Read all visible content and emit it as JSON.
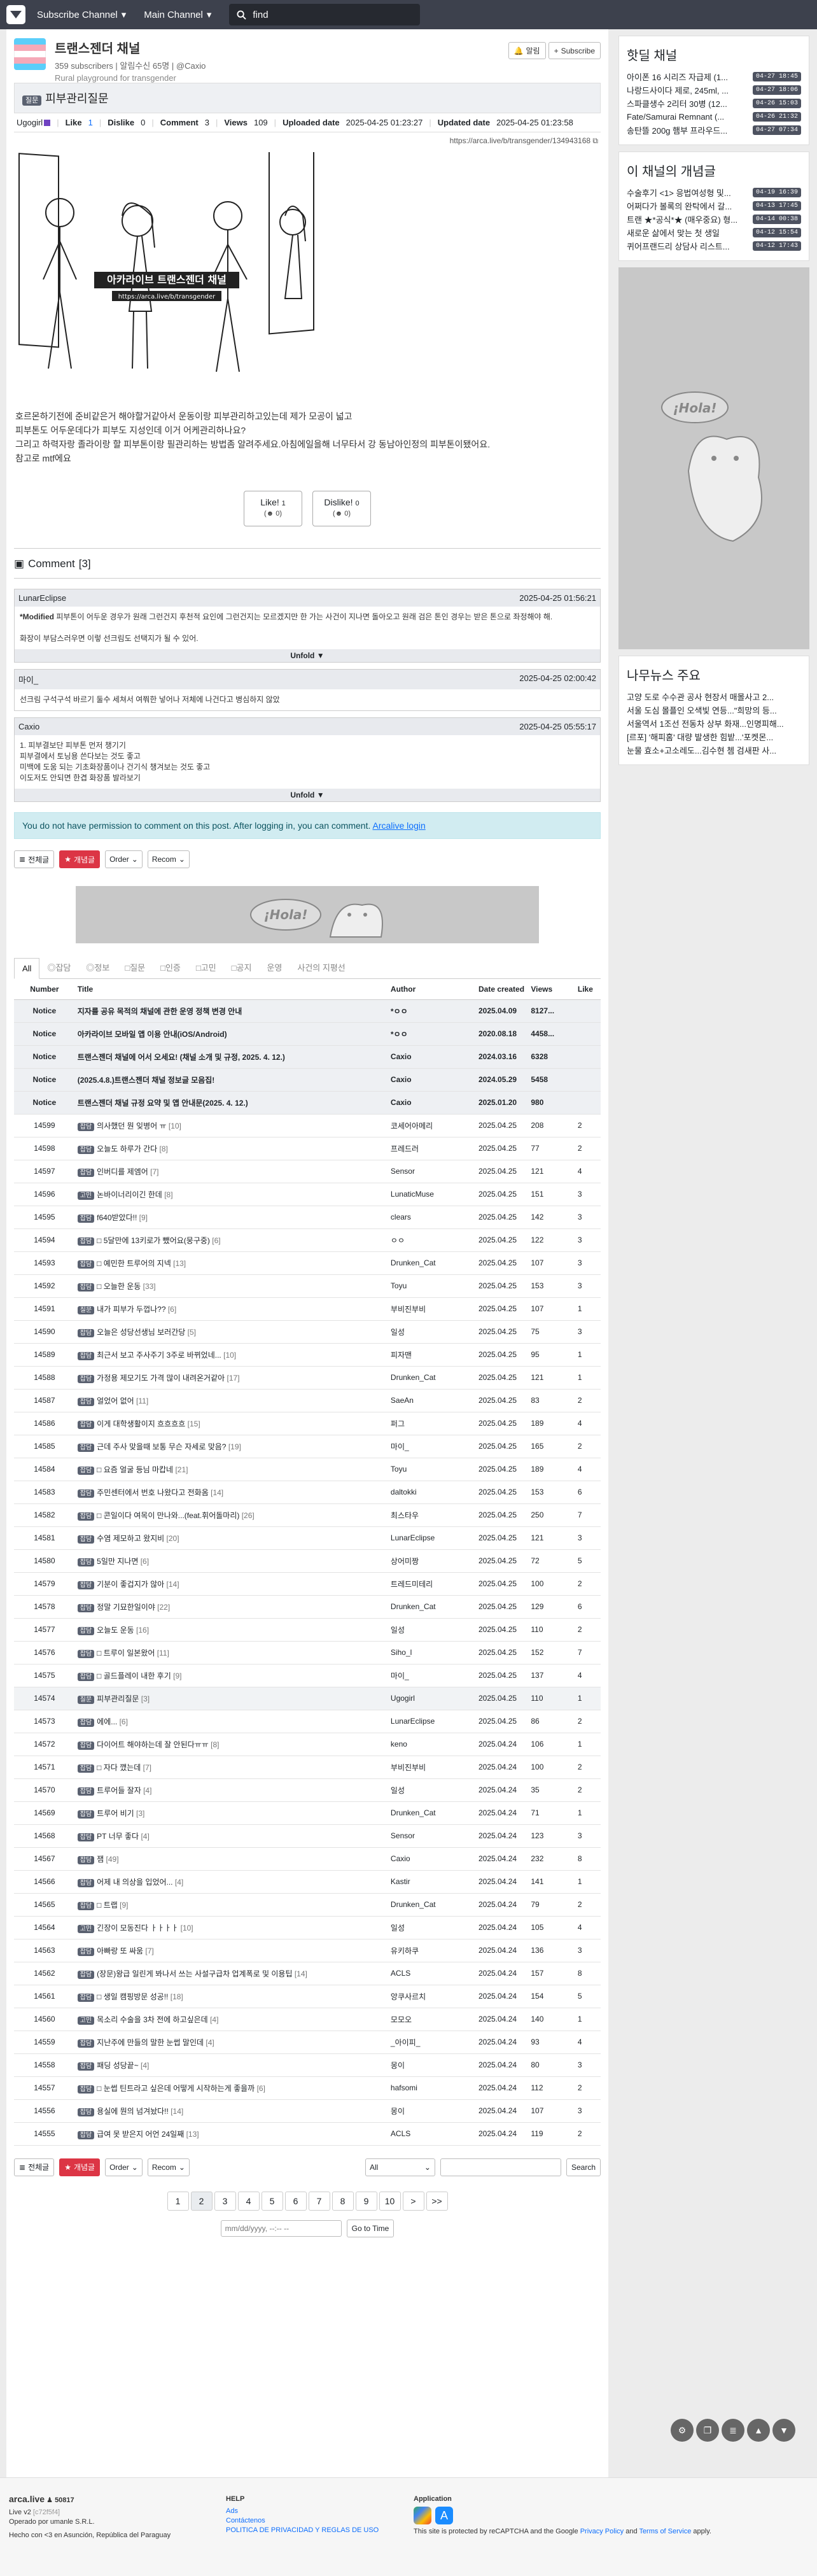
{
  "nav": {
    "menu1": "Subscribe Channel",
    "menu2": "Main Channel",
    "search_placeholder": "find"
  },
  "channel": {
    "name": "트랜스젠더 채널",
    "subscribers": "359 subscribers",
    "notify": "알림수신 65명",
    "owner": "@Caxio",
    "desc": "Rural playground for transgender",
    "notify_btn": "알림",
    "subscribe_btn": "Subscribe"
  },
  "post": {
    "category": "질문",
    "title": "피부관리질문",
    "author": "Ugogirl",
    "like_label": "Like",
    "like": "1",
    "dislike_label": "Dislike",
    "dislike": "0",
    "comment_label": "Comment",
    "comment": "3",
    "views_label": "Views",
    "views": "109",
    "uploaded_label": "Uploaded date",
    "uploaded": "2025-04-25 01:23:27",
    "updated_label": "Updated date",
    "updated": "2025-04-25 01:23:58",
    "url": "https://arca.live/b/transgender/134943168",
    "image_text1": "아카라이브 트랜스젠더 채널",
    "image_text2": "https://arca.live/b/transgender",
    "body": [
      "호르몬하기전에 준비같은거 해야할거같아서 운동이랑 피부관리하고있는데 제가 모공이 넓고",
      "피부톤도 어두운데다가 피부도 지성인데 이거 어케관리하나요?",
      "그리고 하력자랑 졸라이랑 할 피부톤이랑 필관리하는 방법좀 알려주세요.아침에일을해 너무타서 강 동남아인정의 피부톤이됐어요.",
      "참고로 mtf에요"
    ],
    "like_btn": "Like!",
    "like_count": "1",
    "like_sub": "0",
    "dislike_btn": "Dislike!",
    "dislike_count": "0",
    "dislike_sub": "0"
  },
  "comments": {
    "title": "Comment",
    "count": "[3]",
    "items": [
      {
        "author": "LunarEclipse",
        "date": "2025-04-25 01:56:21",
        "modified": "*Modified",
        "text": "피부톤이 어두운 경우가 원래 그런건지 후천적 요인에 그런건지는 모르겠지만 한 가는 사건이 지나면 돌아오고 원래 검은 톤인 경우는 받은 톤으로 좌정해야 해.",
        "text2": "화장이 부담스러우면 이렇 선크림도 선택지가 될 수 있어.",
        "unfold": "Unfold"
      },
      {
        "author": "마이_",
        "date": "2025-04-25 02:00:42",
        "text": "선크림 구석구석 바르기 둘수 세쳐서 여쭤한 넣어나 저체에 나건다고 병심하지 않았",
        "unfold": ""
      },
      {
        "author": "Caxio",
        "date": "2025-04-25 05:55:17",
        "lines": [
          "1. 피부결보단 피부톤 먼저 챙기기",
          "피부결에서 토닝용 쓴다보는 것도 좋고",
          "미백에 도움 되는 기초화장품이나 건기식 챙겨보는 것도 좋고",
          "이도저도 안되면 한겹 화장품 발라보기"
        ],
        "unfold": "Unfold"
      }
    ]
  },
  "alert": {
    "text": "You do not have permission to comment on this post. After logging in, you can comment.",
    "link": "Arcalive login"
  },
  "filters": {
    "all": "전체글",
    "best": "개념글",
    "order": "Order",
    "recom": "Recom"
  },
  "ad": {
    "text": "¡Hola!"
  },
  "tabs": [
    "All",
    "잡담",
    "정보",
    "질문",
    "인증",
    "고민",
    "공지",
    "운영",
    "사건의 지평선"
  ],
  "table": {
    "headers": [
      "Number",
      "Title",
      "Author",
      "Date created",
      "Views",
      "Like"
    ],
    "notices": [
      {
        "num": "Notice",
        "title": "지자를 공유 목적의 채널에 관한 운영 정책 변경 안내",
        "author": "*ㅇㅇ",
        "date": "2025.04.09",
        "views": "8127...",
        "like": ""
      },
      {
        "num": "Notice",
        "title": "아카라이브 모바일 앱 이용 안내(iOS/Android)",
        "author": "*ㅇㅇ",
        "date": "2020.08.18",
        "views": "4458...",
        "like": ""
      },
      {
        "num": "Notice",
        "title": "트랜스젠더 채널에 어서 오세요! (채널 소개 및 규정, 2025. 4. 12.)",
        "author": "Caxio",
        "date": "2024.03.16",
        "views": "6328",
        "like": ""
      },
      {
        "num": "Notice",
        "title": "(2025.4.8.)트랜스젠더 채널 정보글 모음집!",
        "author": "Caxio",
        "date": "2024.05.29",
        "views": "5458",
        "like": ""
      },
      {
        "num": "Notice",
        "title": "트랜스젠더 채널 규정 요약 및 앱 안내문(2025. 4. 12.)",
        "author": "Caxio",
        "date": "2025.01.20",
        "views": "980",
        "like": ""
      }
    ],
    "rows": [
      {
        "num": "14599",
        "cat": "잡담",
        "title": "의사했던 뭔 잊병어 ㅠ",
        "cm": "[10]",
        "author": "코세어아메리",
        "date": "2025.04.25",
        "views": "208",
        "like": "2"
      },
      {
        "num": "14598",
        "cat": "잡담",
        "title": "오늘도 하루가 간다",
        "cm": "[8]",
        "author": "프레드러",
        "date": "2025.04.25",
        "views": "77",
        "like": "2"
      },
      {
        "num": "14597",
        "cat": "잡담",
        "title": "인버디를 제엠어",
        "cm": "[7]",
        "author": "Sensor",
        "date": "2025.04.25",
        "views": "121",
        "like": "4"
      },
      {
        "num": "14596",
        "cat": "고민",
        "title": "논바이너리이긴 한데",
        "cm": "[8]",
        "author": "LunaticMuse",
        "date": "2025.04.25",
        "views": "151",
        "like": "3"
      },
      {
        "num": "14595",
        "cat": "잡담",
        "title": "f640받았다!!",
        "cm": "[9]",
        "author": "clears",
        "date": "2025.04.25",
        "views": "142",
        "like": "3"
      },
      {
        "num": "14594",
        "cat": "잡담",
        "title": "□ 5달만에 13키로가 뺐어요(뭉구중)",
        "cm": "[6]",
        "author": "ㅇㅇ",
        "date": "2025.04.25",
        "views": "122",
        "like": "3"
      },
      {
        "num": "14593",
        "cat": "잡담",
        "title": "□ 예민한 트루어의 지넥",
        "cm": "[13]",
        "author": "Drunken_Cat",
        "date": "2025.04.25",
        "views": "107",
        "like": "3"
      },
      {
        "num": "14592",
        "cat": "잡담",
        "title": "□ 오늘한 운동",
        "cm": "[33]",
        "author": "Toyu",
        "date": "2025.04.25",
        "views": "153",
        "like": "3"
      },
      {
        "num": "14591",
        "cat": "질문",
        "title": "내가 피부가 두껍나??",
        "cm": "[6]",
        "author": "부비진부비",
        "date": "2025.04.25",
        "views": "107",
        "like": "1"
      },
      {
        "num": "14590",
        "cat": "잡담",
        "title": "오늘은 성당선생님 보러간당",
        "cm": "[5]",
        "author": "일성",
        "date": "2025.04.25",
        "views": "75",
        "like": "3"
      },
      {
        "num": "14589",
        "cat": "잡담",
        "title": "최근서 보고 주사주기 3주로 바뀌었네...",
        "cm": "[10]",
        "author": "피자맨",
        "date": "2025.04.25",
        "views": "95",
        "like": "1"
      },
      {
        "num": "14588",
        "cat": "잡담",
        "title": "가정용 제모기도 가격 많이 내려온거같아",
        "cm": "[17]",
        "author": "Drunken_Cat",
        "date": "2025.04.25",
        "views": "121",
        "like": "1"
      },
      {
        "num": "14587",
        "cat": "잡담",
        "title": "얼었어 없어",
        "cm": "[11]",
        "author": "SaeAn",
        "date": "2025.04.25",
        "views": "83",
        "like": "2"
      },
      {
        "num": "14586",
        "cat": "잡담",
        "title": "이게 대학생활이지 흐흐흐흐",
        "cm": "[15]",
        "author": "퍼그",
        "date": "2025.04.25",
        "views": "189",
        "like": "4"
      },
      {
        "num": "14585",
        "cat": "잡담",
        "title": "근데 주사 맞을때 보통 무슨 자세로 맞음?",
        "cm": "[19]",
        "author": "마이_",
        "date": "2025.04.25",
        "views": "165",
        "like": "2"
      },
      {
        "num": "14584",
        "cat": "잡담",
        "title": "□ 요즘 얼굴 등님 마캅네",
        "cm": "[21]",
        "author": "Toyu",
        "date": "2025.04.25",
        "views": "189",
        "like": "4"
      },
      {
        "num": "14583",
        "cat": "잡담",
        "title": "주민센터에서 번호 나왔다고 전화옴",
        "cm": "[14]",
        "author": "daltokki",
        "date": "2025.04.25",
        "views": "153",
        "like": "6"
      },
      {
        "num": "14582",
        "cat": "잡담",
        "title": "□ 콘일이다 여목이 만나와...(feat.휘어돌마리)",
        "cm": "[26]",
        "author": "최스타우",
        "date": "2025.04.25",
        "views": "250",
        "like": "7"
      },
      {
        "num": "14581",
        "cat": "잡담",
        "title": "수염 제모하고 왔지비",
        "cm": "[20]",
        "author": "LunarEclipse",
        "date": "2025.04.25",
        "views": "121",
        "like": "3"
      },
      {
        "num": "14580",
        "cat": "잡담",
        "title": "5일만 지나면",
        "cm": "[6]",
        "author": "상어미짱",
        "date": "2025.04.25",
        "views": "72",
        "like": "5"
      },
      {
        "num": "14579",
        "cat": "잡담",
        "title": "기분이 좋겁지가 않아",
        "cm": "[14]",
        "author": "트레드미테리",
        "date": "2025.04.25",
        "views": "100",
        "like": "2"
      },
      {
        "num": "14578",
        "cat": "잡담",
        "title": "정말 기묘한일이야",
        "cm": "[22]",
        "author": "Drunken_Cat",
        "date": "2025.04.25",
        "views": "129",
        "like": "6"
      },
      {
        "num": "14577",
        "cat": "잡담",
        "title": "오늘도 운동",
        "cm": "[16]",
        "author": "일성",
        "date": "2025.04.25",
        "views": "110",
        "like": "2"
      },
      {
        "num": "14576",
        "cat": "잡담",
        "title": "□ 트루이 일본왔어",
        "cm": "[11]",
        "author": "Siho_l",
        "date": "2025.04.25",
        "views": "152",
        "like": "7"
      },
      {
        "num": "14575",
        "cat": "잡담",
        "title": "□ 골드플레이 내한 후기",
        "cm": "[9]",
        "author": "마이_",
        "date": "2025.04.25",
        "views": "137",
        "like": "4"
      },
      {
        "num": "14574",
        "cat": "질문",
        "title": "피부관리질문",
        "cm": "[3]",
        "author": "Ugogirl",
        "date": "2025.04.25",
        "views": "110",
        "like": "1",
        "hl": true
      },
      {
        "num": "14573",
        "cat": "잡담",
        "title": "에에...",
        "cm": "[6]",
        "author": "LunarEclipse",
        "date": "2025.04.25",
        "views": "86",
        "like": "2"
      },
      {
        "num": "14572",
        "cat": "잡담",
        "title": "다이어트 해야하는데 잘 안된다ㅠㅠ",
        "cm": "[8]",
        "author": "keno",
        "date": "2025.04.24",
        "views": "106",
        "like": "1"
      },
      {
        "num": "14571",
        "cat": "잡담",
        "title": "□ 자다 깼는데",
        "cm": "[7]",
        "author": "부비진부비",
        "date": "2025.04.24",
        "views": "100",
        "like": "2"
      },
      {
        "num": "14570",
        "cat": "잡담",
        "title": "트루어들 잘자",
        "cm": "[4]",
        "author": "일성",
        "date": "2025.04.24",
        "views": "35",
        "like": "2"
      },
      {
        "num": "14569",
        "cat": "잡담",
        "title": "트루어 비기",
        "cm": "[3]",
        "author": "Drunken_Cat",
        "date": "2025.04.24",
        "views": "71",
        "like": "1"
      },
      {
        "num": "14568",
        "cat": "잡담",
        "title": "PT 너무 좋다",
        "cm": "[4]",
        "author": "Sensor",
        "date": "2025.04.24",
        "views": "123",
        "like": "3"
      },
      {
        "num": "14567",
        "cat": "잡담",
        "title": "잼",
        "cm": "[49]",
        "author": "Caxio",
        "date": "2025.04.24",
        "views": "232",
        "like": "8"
      },
      {
        "num": "14566",
        "cat": "잡담",
        "title": "어제 내 의상을 입었어...",
        "cm": "[4]",
        "author": "Kastir",
        "date": "2025.04.24",
        "views": "141",
        "like": "1"
      },
      {
        "num": "14565",
        "cat": "잡담",
        "title": "□ 트랩",
        "cm": "[9]",
        "author": "Drunken_Cat",
        "date": "2025.04.24",
        "views": "79",
        "like": "2"
      },
      {
        "num": "14564",
        "cat": "고민",
        "title": "긴장이 모동진다 ㅏㅏㅏㅏ",
        "cm": "[10]",
        "author": "일성",
        "date": "2025.04.24",
        "views": "105",
        "like": "4"
      },
      {
        "num": "14563",
        "cat": "잡담",
        "title": "아빠랑 또 싸움",
        "cm": "[7]",
        "author": "유키하쿠",
        "date": "2025.04.24",
        "views": "136",
        "like": "3"
      },
      {
        "num": "14562",
        "cat": "잡담",
        "title": "(장문)왕급 일린게 봐나서 쓰는 사설구급차 업계폭로 및 이용팁",
        "cm": "[14]",
        "author": "ACLS",
        "date": "2025.04.24",
        "views": "157",
        "like": "8"
      },
      {
        "num": "14561",
        "cat": "잡담",
        "title": "□ 생일 캠핑방문 성공!!",
        "cm": "[18]",
        "author": "앙쿠사르치",
        "date": "2025.04.24",
        "views": "154",
        "like": "5"
      },
      {
        "num": "14560",
        "cat": "고민",
        "title": "목소리 수술을 3차 전에 하고싶은데",
        "cm": "[4]",
        "author": "모모오",
        "date": "2025.04.24",
        "views": "140",
        "like": "1"
      },
      {
        "num": "14559",
        "cat": "잡담",
        "title": "지난주에 만들의 말한 눈썹 말인데",
        "cm": "[4]",
        "author": "_아이피_",
        "date": "2025.04.24",
        "views": "93",
        "like": "4"
      },
      {
        "num": "14558",
        "cat": "잡담",
        "title": "패딩 성당끝~",
        "cm": "[4]",
        "author": "몽이",
        "date": "2025.04.24",
        "views": "80",
        "like": "3"
      },
      {
        "num": "14557",
        "cat": "잡담",
        "title": "□ 눈썹 틴트라고 싶은데 어떻게 시작하는게 좋을까",
        "cm": "[6]",
        "author": "hafsomi",
        "date": "2025.04.24",
        "views": "112",
        "like": "2"
      },
      {
        "num": "14556",
        "cat": "잡담",
        "title": "용실에 뭔의 넘겨놨다!!",
        "cm": "[14]",
        "author": "몽이",
        "date": "2025.04.24",
        "views": "107",
        "like": "3"
      },
      {
        "num": "14555",
        "cat": "잡담",
        "title": "급여 못 받은지 어언 24일째",
        "cm": "[13]",
        "author": "ACLS",
        "date": "2025.04.24",
        "views": "119",
        "like": "2"
      }
    ]
  },
  "pager": {
    "pages": [
      "1",
      "2",
      "3",
      "4",
      "5",
      "6",
      "7",
      "8",
      "9",
      "10"
    ],
    "next": ">",
    "last": ">>",
    "current": "2"
  },
  "search": {
    "select": "All",
    "button": "Search",
    "date_placeholder": "mm/dd/yyyy, --:-- --",
    "goto": "Go to Time"
  },
  "sidebar": {
    "hot_title": "핫딜 채널",
    "hot": [
      {
        "t": "아이폰 16 시리즈 자급제 (1...",
        "d": "04-27 18:45"
      },
      {
        "t": "나랑드사이다 제로, 245ml, ...",
        "d": "04-27 18:06"
      },
      {
        "t": "스파클생수 2리터 30병 (12...",
        "d": "04-26 15:03"
      },
      {
        "t": "Fate/Samurai Remnant (...",
        "d": "04-26 21:32"
      },
      {
        "t": "송탄뜰 200g 햄부 프라우드...",
        "d": "04-27 07:34"
      }
    ],
    "concept_title": "이 채널의 개념글",
    "concept": [
      {
        "t": "수술후기 <1> 응법여성형 및...",
        "d": "04-19 16:39"
      },
      {
        "t": "어쩌다가 볼록의 완탁에서 갈...",
        "d": "04-13 17:45"
      },
      {
        "t": "트랜 ★*공식*★ (매우중요) 형...",
        "d": "04-14 00:38"
      },
      {
        "t": "새로운 삶에서 맞는 첫 생일",
        "d": "04-12 15:54"
      },
      {
        "t": "퀴어프랜드리 상담사 리스트...",
        "d": "04-12 17:43"
      }
    ],
    "side_ad": "¡Hola!",
    "news_title": "나무뉴스 주요",
    "news": [
      "고양 도로 수수관 공사 현장서 매몰사고 2...",
      "서울 도심 몰플인 오색빛 연등...\"희망의 등...",
      "서울역서 1조선 전동차 상부 화재...인명피해...",
      "[르포] '해피홈' 대량 발생한 힘밭...'포켓몬...",
      "눈물 효소+고소레도...김수현 쳄 검새판 사..."
    ]
  },
  "footer": {
    "brand": "arca.live",
    "count": "50817",
    "version": "Live v2",
    "version_sub": "[c72f5f4]",
    "operator": "Operado por umanle S.R.L.",
    "hecho": "Hecho con <3 en Asunción, República del Paraguay",
    "help_title": "HELP",
    "help": [
      "Ads",
      "Contáctenos",
      "POLITICA DE PRIVACIDAD Y REGLAS DE USO"
    ],
    "app_title": "Application",
    "recaptcha": "This site is protected by reCAPTCHA and the Google",
    "privacy": "Privacy Policy",
    "and": "and",
    "terms": "Terms of Service",
    "apply": "apply."
  },
  "colors": {
    "nav": "#3d414d",
    "red": "#dc3545",
    "link": "#0d6efd",
    "alert_bg": "#d1ecf1"
  }
}
